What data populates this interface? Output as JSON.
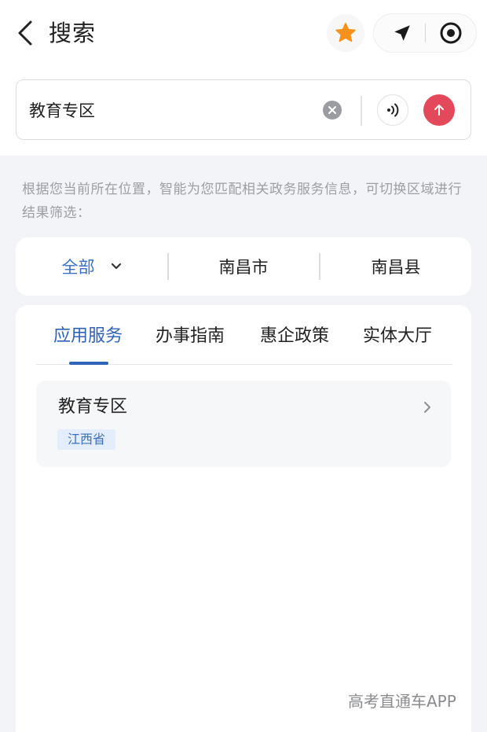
{
  "header": {
    "title": "搜索",
    "back_icon": "chevron-left-icon",
    "favorite_icon": "star-icon",
    "navigate_icon": "navigation-arrow-icon",
    "record_icon": "target-circle-icon",
    "star_color": "#f5921e"
  },
  "search": {
    "value": "教育专区",
    "clear_icon": "clear-icon",
    "voice_icon": "voice-wave-icon",
    "submit_icon": "arrow-up-icon",
    "submit_color": "#e3495a"
  },
  "hint": "根据您当前所在位置，智能为您匹配相关政务服务信息，可切换区域进行结果筛选：",
  "regions": {
    "all": "全部",
    "city": "南昌市",
    "county": "南昌县",
    "accent": "#3a6fc4"
  },
  "tabs": [
    {
      "label": "应用服务",
      "active": true
    },
    {
      "label": "办事指南",
      "active": false
    },
    {
      "label": "惠企政策",
      "active": false
    },
    {
      "label": "实体大厅",
      "active": false
    }
  ],
  "results": [
    {
      "title": "教育专区",
      "tag": "江西省"
    }
  ],
  "watermark": "高考直通车APP"
}
